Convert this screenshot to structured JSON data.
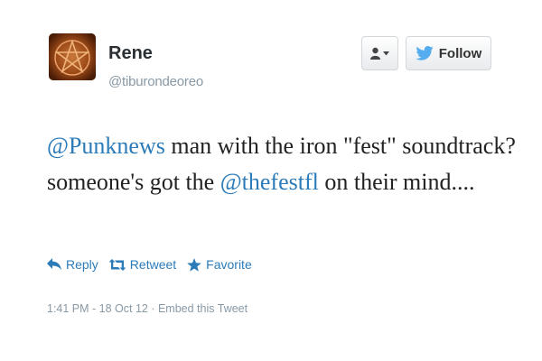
{
  "user": {
    "name": "Rene",
    "handle": "@tiburondeoreo"
  },
  "header": {
    "follow_label": "Follow",
    "user_dropdown_icon": "user-icon"
  },
  "tweet": {
    "mention_1": "@Punknews",
    "text_1": " man with the iron \"fest\" soundtrack? someone's got the ",
    "mention_2": "@thefestfl",
    "text_2": " on their mind...."
  },
  "actions": {
    "reply_label": "Reply",
    "retweet_label": "Retweet",
    "favorite_label": "Favorite"
  },
  "meta": {
    "timestamp": "1:41 PM - 18 Oct 12",
    "separator": " · ",
    "embed_label": "Embed this Tweet"
  },
  "colors": {
    "link": "#2b7bb9",
    "twitter_bird": "#55acee",
    "muted": "#8899a6"
  }
}
